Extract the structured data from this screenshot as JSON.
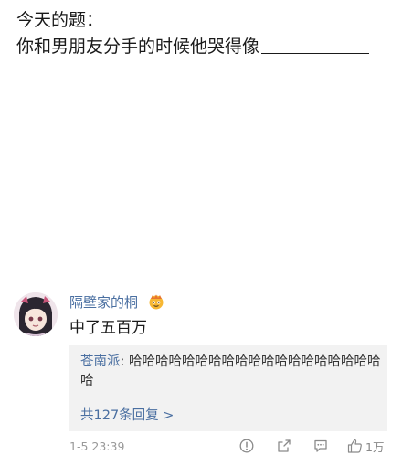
{
  "post": {
    "line1": "今天的题：",
    "line2": "你和男朋友分手的时候他哭得像"
  },
  "comment": {
    "username": "隔壁家的桐",
    "text": "中了五百万",
    "avatar_icon": "anime-avatar-icon",
    "badge_icon": "vip-badge-icon",
    "reply": {
      "user": "苍南派",
      "separator": ": ",
      "text": "哈哈哈哈哈哈哈哈哈哈哈哈哈哈哈哈哈哈哈哈"
    },
    "more_replies": "共127条回复 >",
    "time": "1-5 23:39",
    "likes": "1万"
  },
  "colors": {
    "link": "#4a6fa1",
    "reply_bg": "#f2f2f2",
    "meta": "#999999"
  }
}
